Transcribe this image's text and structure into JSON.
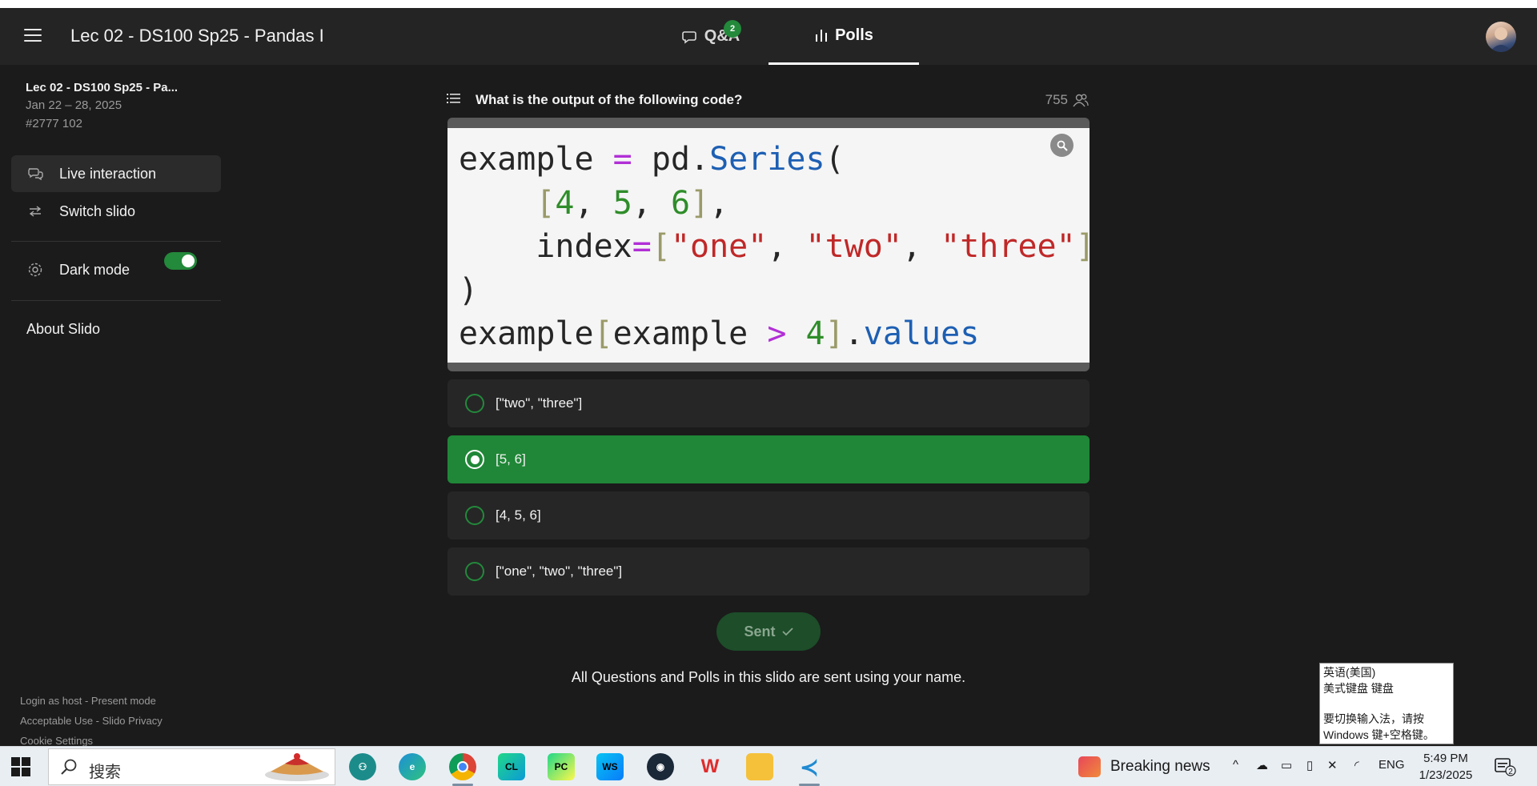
{
  "header": {
    "title": "Lec 02 - DS100 Sp25 - Pandas I",
    "tabs": [
      {
        "label": "Q&A",
        "badge": "2"
      },
      {
        "label": "Polls"
      }
    ]
  },
  "sidebar": {
    "event_title": "Lec 02 - DS100 Sp25 - Pa...",
    "event_dates": "Jan 22 – 28, 2025",
    "event_code": "#2777 102",
    "nav": {
      "live": "Live interaction",
      "switch": "Switch slido",
      "dark_mode": "Dark mode",
      "about": "About Slido"
    },
    "dark_mode_on": true,
    "footer": {
      "login": "Login as host",
      "sep": " - ",
      "present": "Present mode",
      "acceptable": "Acceptable Use",
      "privacy": "Slido Privacy",
      "cookies": "Cookie Settings"
    }
  },
  "poll": {
    "question": "What is the output of the following code?",
    "participants": "755",
    "code_lines": [
      "example = pd.Series(",
      "    [4, 5, 6],",
      "    index=[\"one\", \"two\", \"three\"]",
      ")",
      "example[example > 4].values"
    ],
    "options": [
      {
        "label": "[\"two\", \"three\"]",
        "selected": false
      },
      {
        "label": "[5, 6]",
        "selected": true
      },
      {
        "label": "[4, 5, 6]",
        "selected": false
      },
      {
        "label": "[\"one\", \"two\", \"three\"]",
        "selected": false
      }
    ],
    "submit_label": "Sent",
    "note": "All Questions and Polls in this slido are sent using your name."
  },
  "ime_tooltip": {
    "line1": "英语(美国)",
    "line2": "美式键盘 键盘",
    "line3": "要切换输入法，请按",
    "line4": "Windows 键+空格键。"
  },
  "taskbar": {
    "search_placeholder": "搜索",
    "news": "Breaking news",
    "lang": "ENG",
    "time": "5:49 PM",
    "date": "1/23/2025",
    "notifications": "2"
  },
  "colors": {
    "accent_green": "#1f8737",
    "background": "#1b1b1b"
  }
}
